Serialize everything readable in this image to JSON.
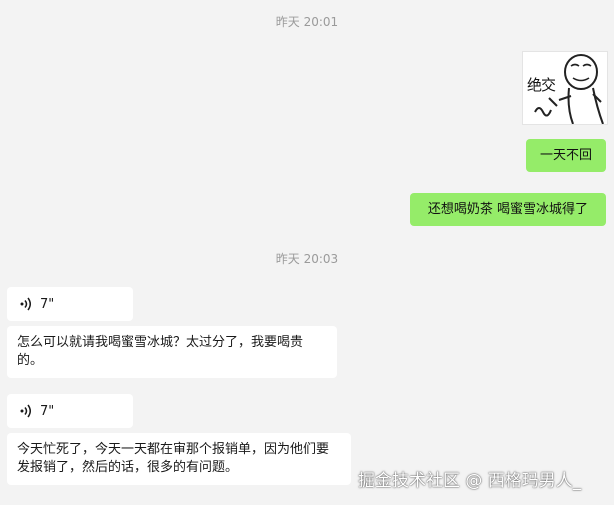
{
  "timestamps": [
    "昨天 20:01",
    "昨天 20:03"
  ],
  "sent": {
    "sticker_text": "绝交",
    "msg1": "一天不回",
    "msg2": "还想喝奶茶 喝蜜雪冰城得了"
  },
  "received": {
    "voice1_duration": "7\"",
    "text1": "怎么可以就请我喝蜜雪冰城？太过分了，我要喝贵的。",
    "voice2_duration": "7\"",
    "text2": "今天忙死了，今天一天都在审那个报销单，因为他们要发报销了，然后的话，很多的有问题。"
  },
  "watermark": "掘金技术社区 @ 西格玛男人_",
  "colors": {
    "background": "#f3f3f3",
    "sent_bubble": "#95ec69",
    "received_bubble": "#ffffff",
    "timestamp": "#9a9a9a"
  },
  "icons": {
    "voice": "voice-wave-icon"
  }
}
